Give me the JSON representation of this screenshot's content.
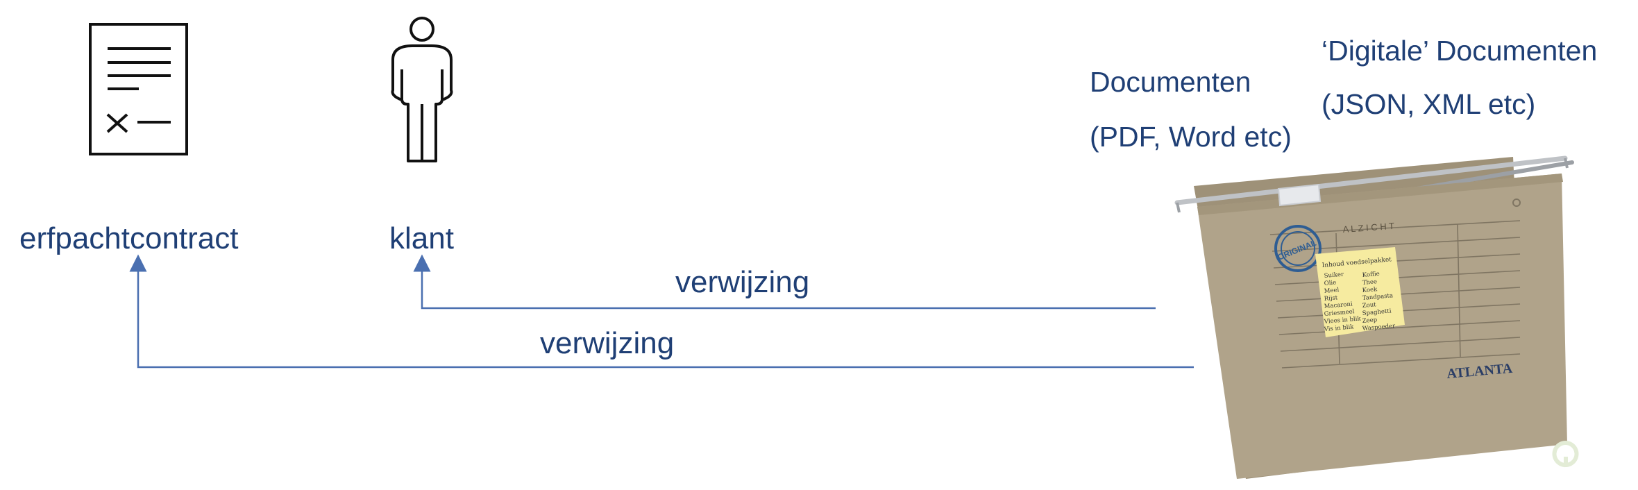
{
  "nodes": {
    "contract": {
      "label": "erfpachtcontract",
      "icon": "document-icon"
    },
    "client": {
      "label": "klant",
      "icon": "person-icon"
    }
  },
  "edges": [
    {
      "from": "folder",
      "to": "client",
      "label": "verwijzing"
    },
    {
      "from": "folder",
      "to": "contract",
      "label": "verwijzing"
    }
  ],
  "folder": {
    "icon": "hanging-file-folder",
    "docs_title": "Documenten",
    "docs_formats": "(PDF, Word etc)",
    "digital_title": "‘Digitale’ Documenten",
    "digital_formats": "(JSON, XML etc)",
    "header_text": "A L Z I C H T",
    "stamp_text": "ORIGINAL",
    "brand": "ATLANTA",
    "note": {
      "title": "Inhoud voedselpakket",
      "col1": [
        "Suiker",
        "Olie",
        "Meel",
        "Rijst",
        "Macaroni",
        "Griesmeel",
        "Vlees in blik",
        "Vis in blik"
      ],
      "col2": [
        "Koffie",
        "Thee",
        "Koek",
        "Tandpasta",
        "Zout",
        "Spaghetti",
        "Zeep",
        "Waspoeder"
      ]
    }
  },
  "colors": {
    "text": "#1f3f75",
    "arrow": "#4a6fb0",
    "folder": "#b0a38a",
    "note": "#f6eba0"
  }
}
